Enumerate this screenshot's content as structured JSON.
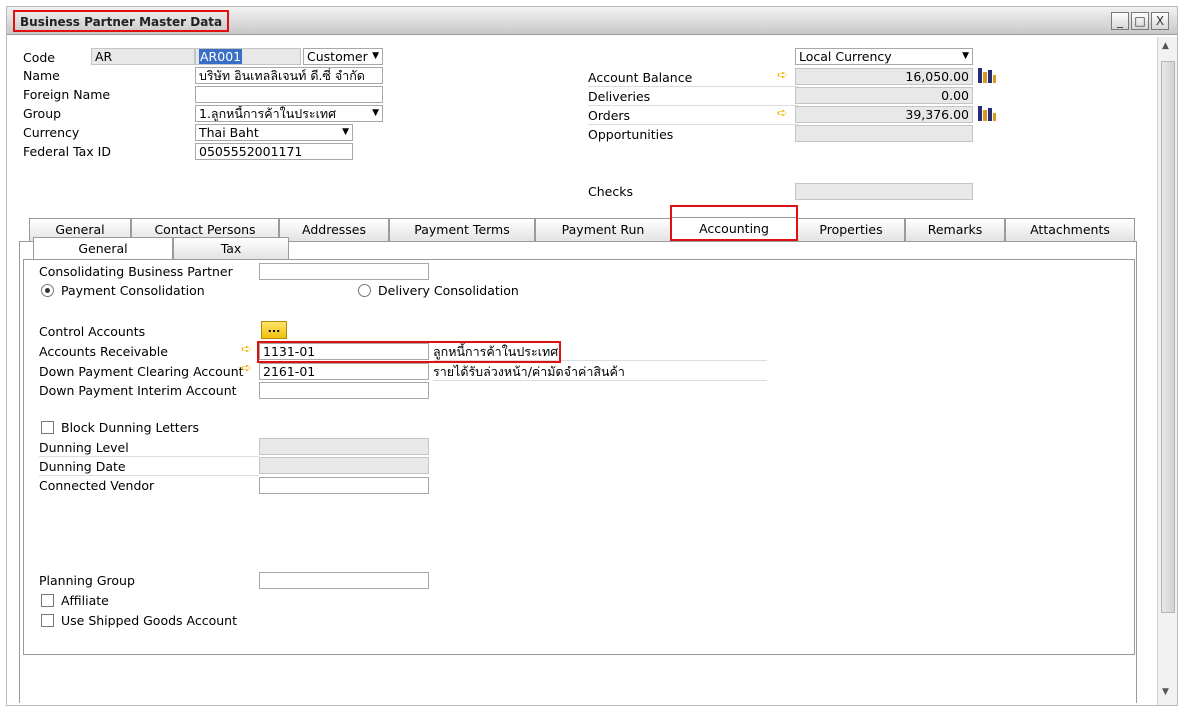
{
  "window": {
    "title": "Business Partner Master Data",
    "minimize": "_",
    "maximize": "□",
    "close": "X"
  },
  "header": {
    "code_label": "Code",
    "code_series": "AR",
    "code_value": "AR001",
    "bp_type": "Customer",
    "name_label": "Name",
    "name_value": "บริษัท อินเทลลิเจนท์ ดี.ซี่ จำกัด",
    "foreign_name_label": "Foreign Name",
    "foreign_name_value": "",
    "group_label": "Group",
    "group_value": "1.ลูกหนี้การค้าในประเทศ",
    "currency_label": "Currency",
    "currency_value": "Thai Baht",
    "tax_id_label": "Federal Tax ID",
    "tax_id_value": "0505552001171"
  },
  "balances": {
    "currency_select": "Local Currency",
    "account_balance_label": "Account Balance",
    "account_balance_value": "16,050.00",
    "deliveries_label": "Deliveries",
    "deliveries_value": "0.00",
    "orders_label": "Orders",
    "orders_value": "39,376.00",
    "opportunities_label": "Opportunities",
    "opportunities_value": "",
    "checks_label": "Checks",
    "checks_value": ""
  },
  "tabs": [
    {
      "label": "General"
    },
    {
      "label": "Contact Persons"
    },
    {
      "label": "Addresses"
    },
    {
      "label": "Payment Terms"
    },
    {
      "label": "Payment Run"
    },
    {
      "label": "Accounting"
    },
    {
      "label": "Properties"
    },
    {
      "label": "Remarks"
    },
    {
      "label": "Attachments"
    }
  ],
  "active_tab": "Accounting",
  "subtabs": [
    {
      "label": "General"
    },
    {
      "label": "Tax"
    }
  ],
  "accounting": {
    "consolidating_bp_label": "Consolidating Business Partner",
    "consolidating_bp_value": "",
    "payment_consolidation_label": "Payment Consolidation",
    "delivery_consolidation_label": "Delivery Consolidation",
    "control_accounts_label": "Control Accounts",
    "control_accounts_button": "...",
    "accounts_receivable_label": "Accounts Receivable",
    "accounts_receivable_code": "1131-01",
    "accounts_receivable_name": "ลูกหนี้การค้าในประเทศ",
    "dp_clearing_label": "Down Payment Clearing Account",
    "dp_clearing_code": "2161-01",
    "dp_clearing_name": "รายได้รับล่วงหน้า/ค่ามัดจำค่าสินค้า",
    "dp_interim_label": "Down Payment Interim Account",
    "dp_interim_value": "",
    "block_dunning_label": "Block Dunning Letters",
    "dunning_level_label": "Dunning Level",
    "dunning_date_label": "Dunning Date",
    "connected_vendor_label": "Connected Vendor",
    "connected_vendor_value": "",
    "planning_group_label": "Planning Group",
    "planning_group_value": "",
    "affiliate_label": "Affiliate",
    "shipped_goods_label": "Use Shipped Goods Account"
  },
  "colors": {
    "highlight_red": "#e01010",
    "link_arrow": "#f2b300",
    "selected_code_bg": "#3a6fc8"
  }
}
